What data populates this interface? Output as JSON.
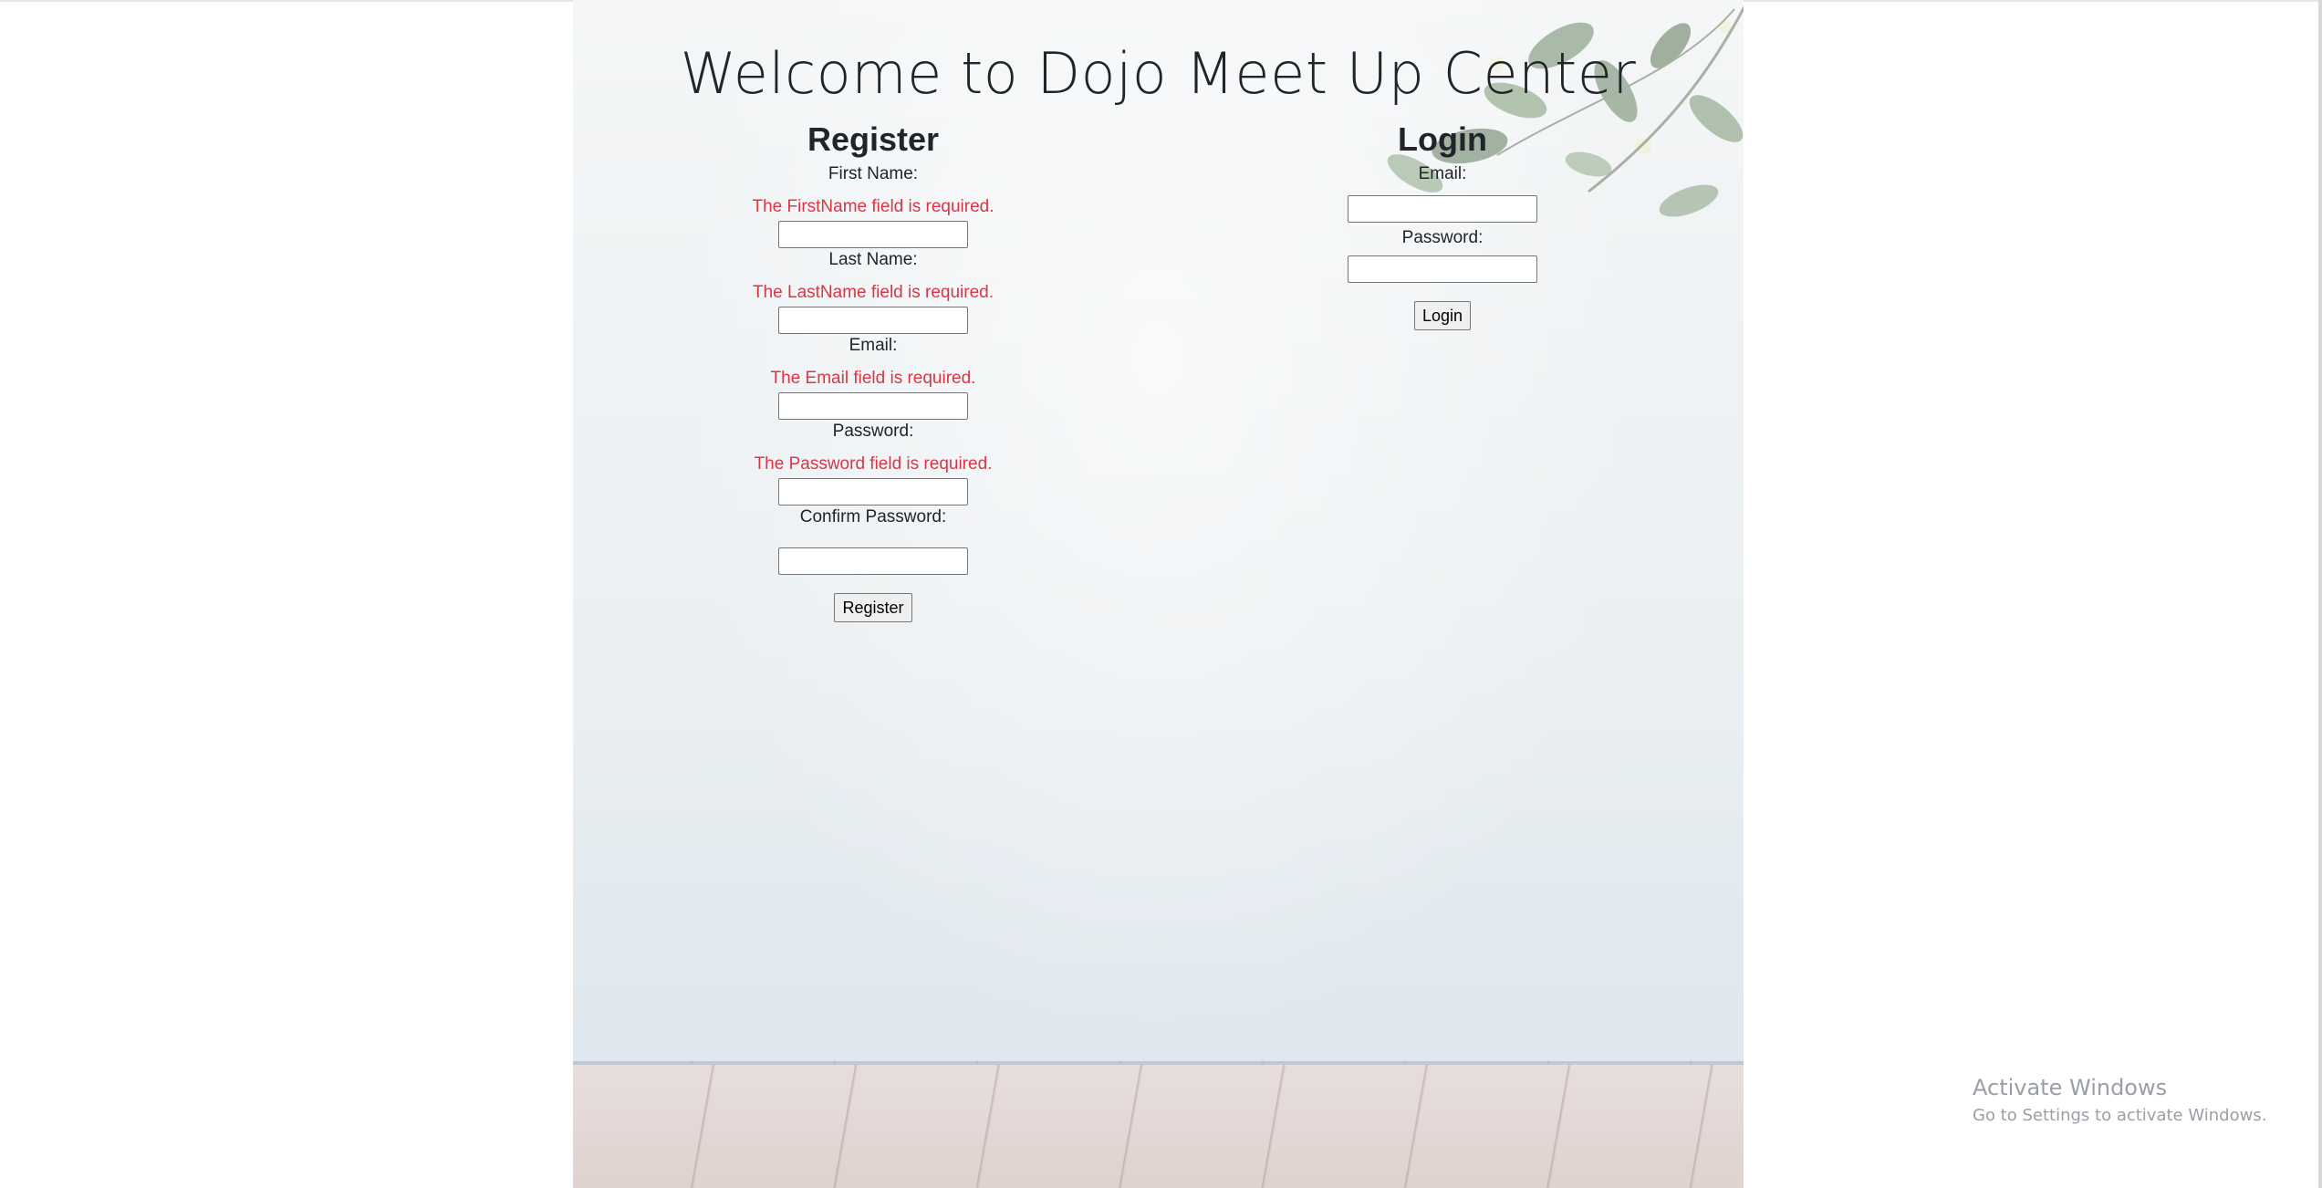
{
  "page": {
    "title": "Welcome to Dojo Meet Up Center"
  },
  "register": {
    "heading": "Register",
    "first_name_label": "First Name:",
    "first_name_error": "The FirstName field is required.",
    "first_name_value": "",
    "last_name_label": "Last Name:",
    "last_name_error": "The LastName field is required.",
    "last_name_value": "",
    "email_label": "Email:",
    "email_error": "The Email field is required.",
    "email_value": "",
    "password_label": "Password:",
    "password_error": "The Password field is required.",
    "password_value": "",
    "confirm_password_label": "Confirm Password:",
    "confirm_password_value": "",
    "submit_label": "Register"
  },
  "login": {
    "heading": "Login",
    "email_label": "Email:",
    "email_value": "",
    "password_label": "Password:",
    "password_value": "",
    "submit_label": "Login"
  },
  "watermark": {
    "line1": "Activate Windows",
    "line2": "Go to Settings to activate Windows."
  },
  "colors": {
    "error": "#dc3545",
    "text": "#212529"
  }
}
